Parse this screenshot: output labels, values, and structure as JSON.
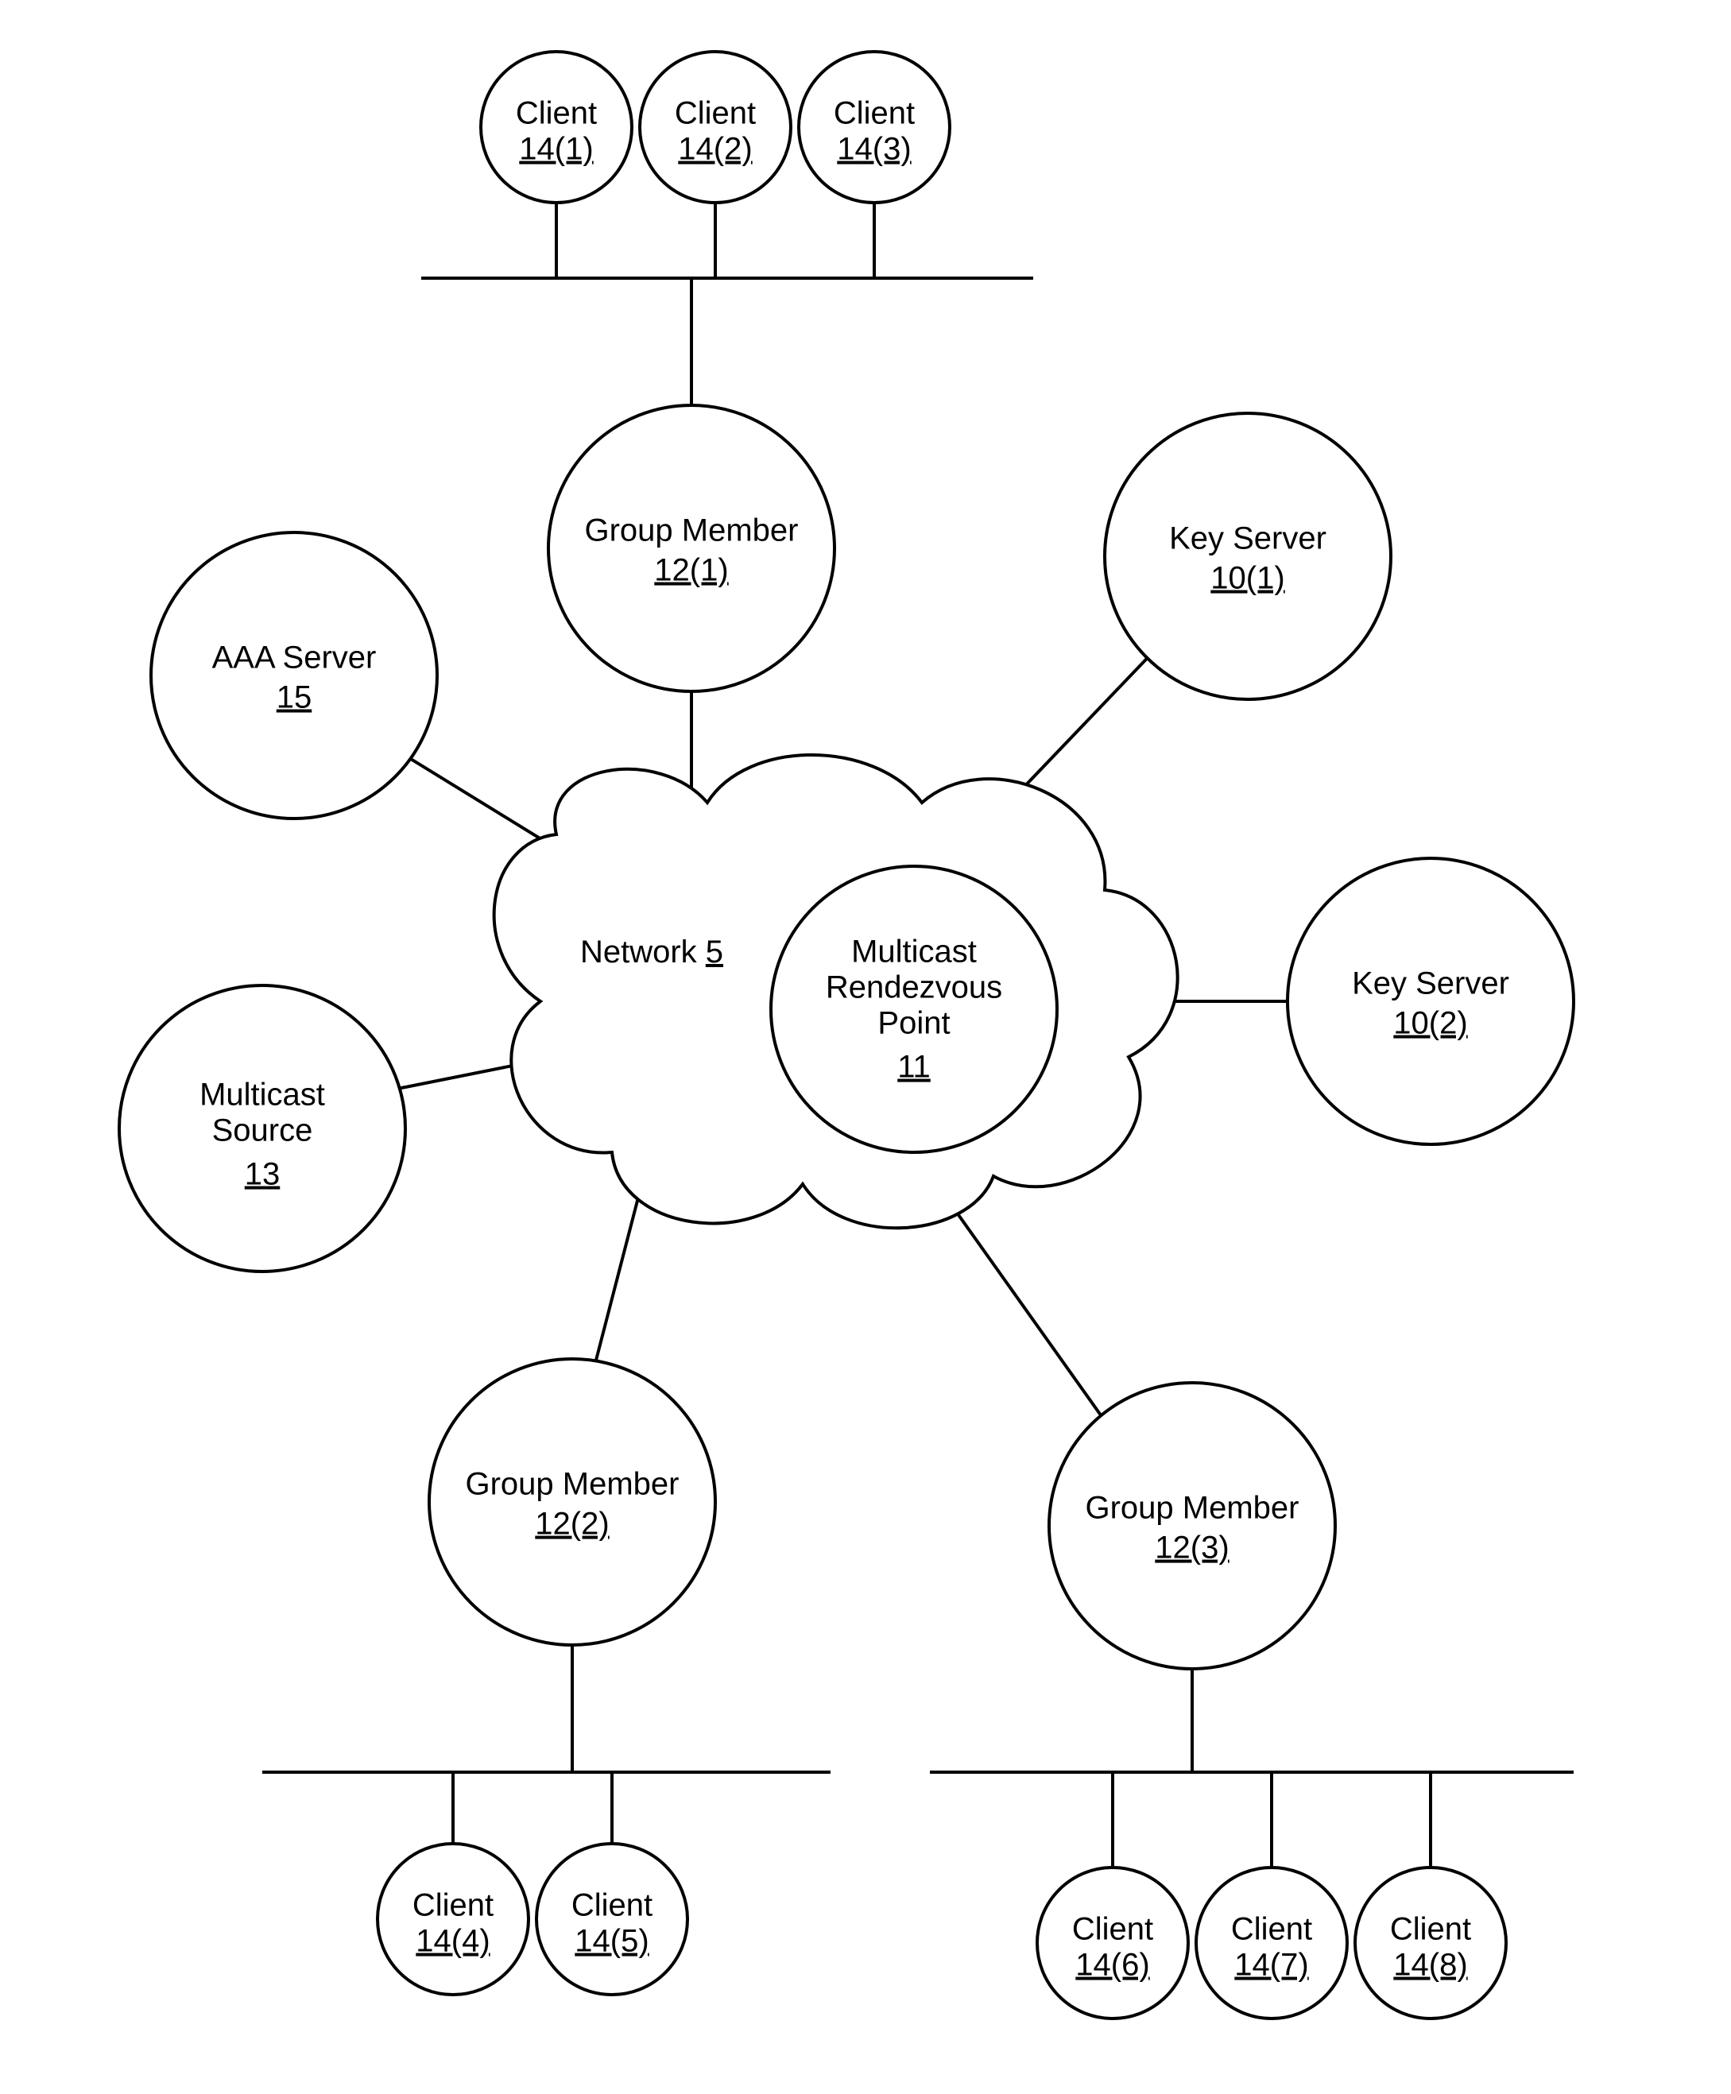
{
  "network": {
    "label": "Network",
    "ref": "5"
  },
  "rendezvous": {
    "line1": "Multicast",
    "line2": "Rendezvous",
    "line3": "Point",
    "ref": "11"
  },
  "nodes": {
    "aaa": {
      "label": "AAA Server",
      "ref": "15"
    },
    "msource": {
      "line1": "Multicast",
      "line2": "Source",
      "ref": "13"
    },
    "gm1": {
      "label": "Group Member",
      "ref": "12(1)"
    },
    "gm2": {
      "label": "Group Member",
      "ref": "12(2)"
    },
    "gm3": {
      "label": "Group Member",
      "ref": "12(3)"
    },
    "ks1": {
      "label": "Key Server",
      "ref": "10(1)"
    },
    "ks2": {
      "label": "Key Server",
      "ref": "10(2)"
    },
    "clients": [
      {
        "label": "Client",
        "ref": "14(1)"
      },
      {
        "label": "Client",
        "ref": "14(2)"
      },
      {
        "label": "Client",
        "ref": "14(3)"
      },
      {
        "label": "Client",
        "ref": "14(4)"
      },
      {
        "label": "Client",
        "ref": "14(5)"
      },
      {
        "label": "Client",
        "ref": "14(6)"
      },
      {
        "label": "Client",
        "ref": "14(7)"
      },
      {
        "label": "Client",
        "ref": "14(8)"
      }
    ]
  }
}
